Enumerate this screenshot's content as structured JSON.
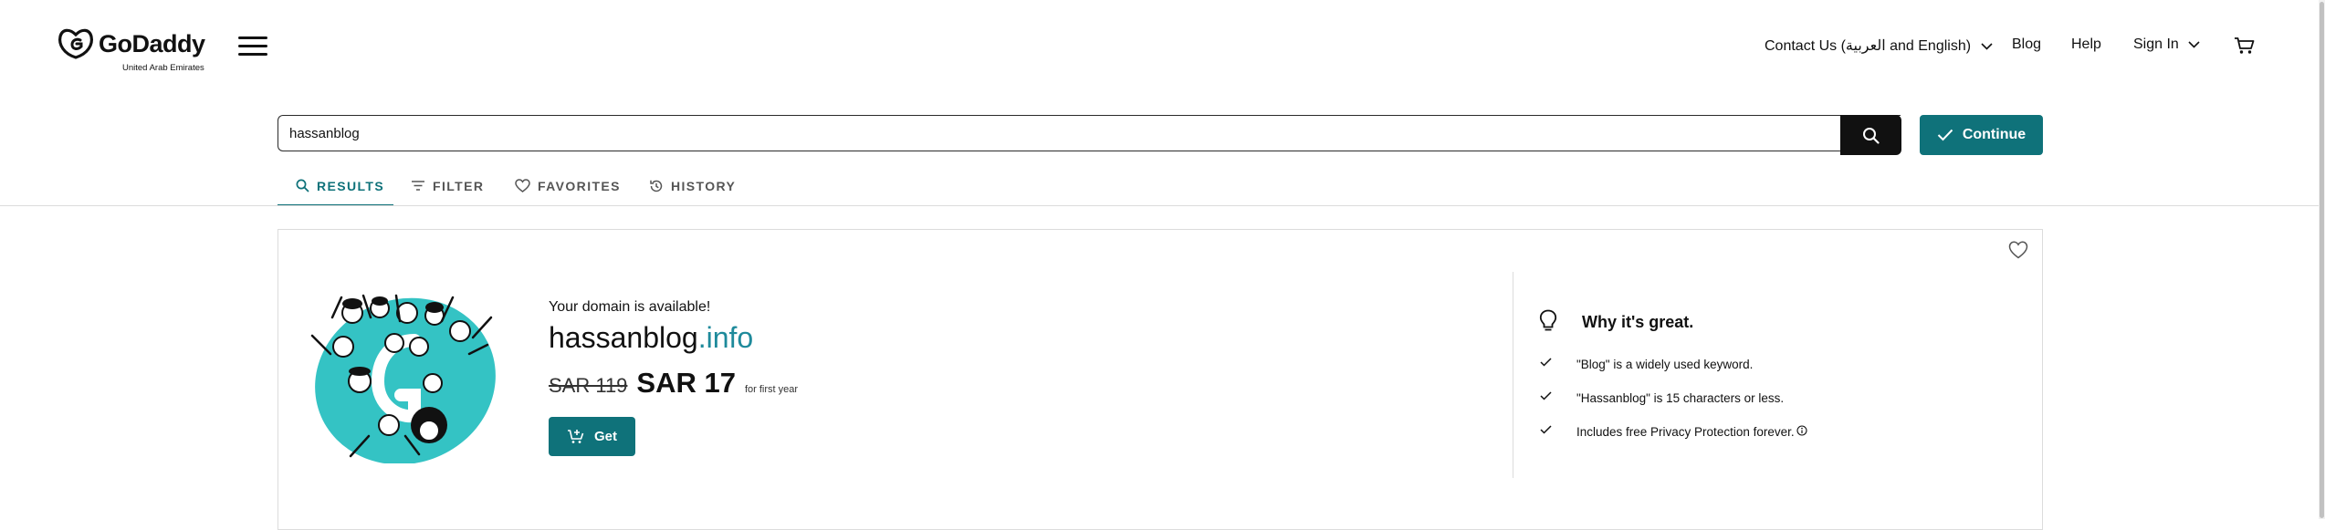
{
  "brand": {
    "name": "GoDaddy",
    "region": "United Arab Emirates",
    "logo_icon": "godaddy-logo-icon"
  },
  "header": {
    "menu_icon": "hamburger-menu-icon",
    "contact_label": "Contact Us (العربية and English)",
    "blog_label": "Blog",
    "help_label": "Help",
    "signin_label": "Sign In",
    "cart_icon": "cart-icon"
  },
  "search": {
    "value": "hassanblog",
    "button_icon": "search-icon",
    "continue_label": "Continue"
  },
  "tabs": [
    {
      "label": "RESULTS",
      "icon": "search-icon",
      "active": true
    },
    {
      "label": "FILTER",
      "icon": "filter-icon",
      "active": false
    },
    {
      "label": "FAVORITES",
      "icon": "heart-icon",
      "active": false
    },
    {
      "label": "HISTORY",
      "icon": "history-icon",
      "active": false
    }
  ],
  "result": {
    "status_text": "Your domain is available!",
    "domain_name": "hassanblog",
    "domain_tld": ".info",
    "old_price": "SAR 119",
    "new_price": "SAR 17",
    "price_period": "for first year",
    "get_label": "Get"
  },
  "why": {
    "title": "Why it's great.",
    "items": [
      "\"Blog\" is a widely used keyword.",
      "\"Hassanblog\" is 15 characters or less.",
      "Includes free Privacy Protection forever."
    ]
  },
  "colors": {
    "accent": "#0f727a",
    "tld": "#1e8a9b",
    "illustration": "#34c3c4",
    "search_button": "#111111"
  }
}
